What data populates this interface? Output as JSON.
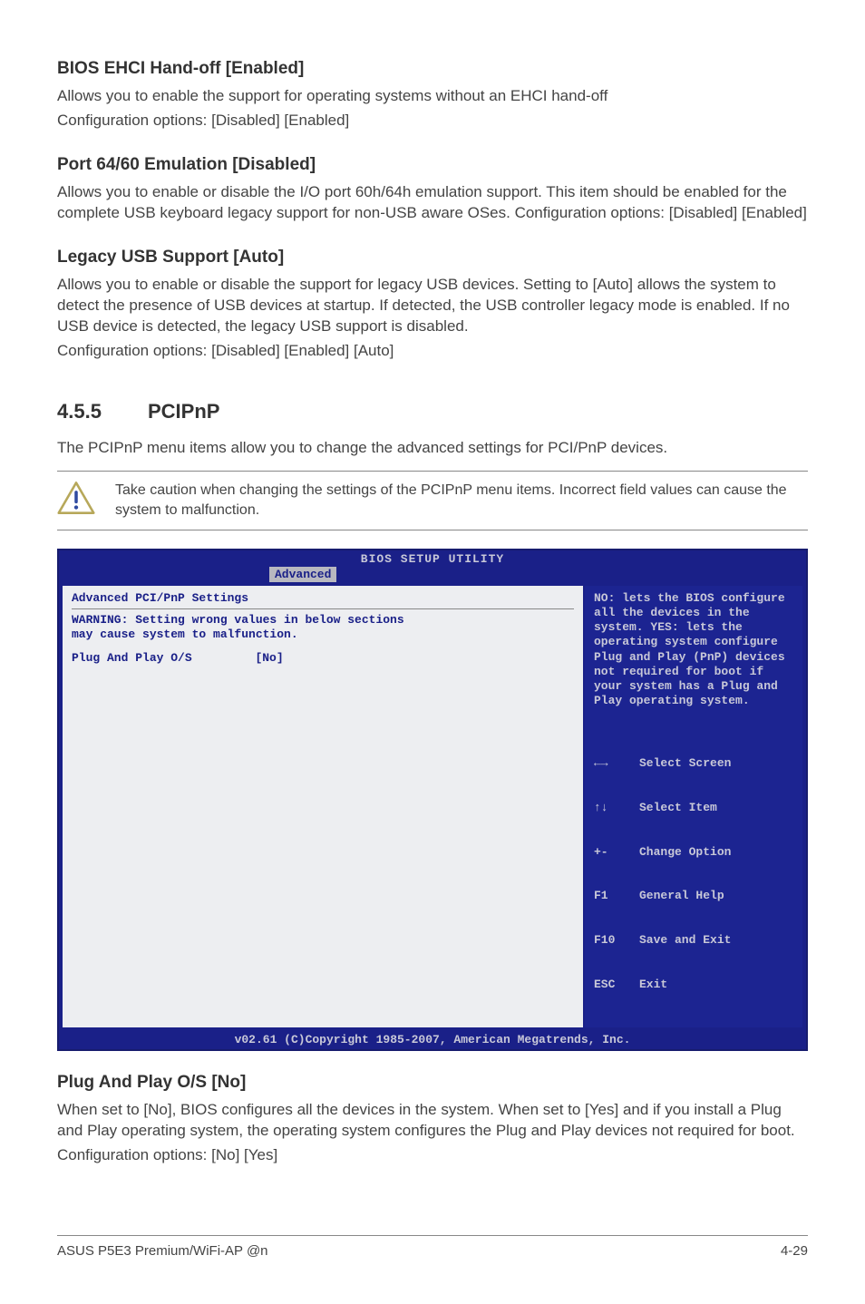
{
  "s1": {
    "head": "BIOS EHCI Hand-off [Enabled]",
    "p1": "Allows you to enable the support for operating systems without an EHCI hand-off",
    "p2": "Configuration options: [Disabled] [Enabled]"
  },
  "s2": {
    "head": "Port 64/60 Emulation [Disabled]",
    "p1": "Allows you to enable or disable the I/O port 60h/64h emulation support. This item should be enabled for the complete USB keyboard legacy support for non-USB aware OSes. Configuration options: [Disabled] [Enabled]"
  },
  "s3": {
    "head": "Legacy USB Support [Auto]",
    "p1": "Allows you to enable or disable the support for legacy USB devices. Setting to [Auto] allows the system to detect the presence of USB devices at startup. If detected, the USB controller legacy mode is enabled. If no USB device is detected, the legacy USB support is disabled.",
    "p2": "Configuration options: [Disabled] [Enabled] [Auto]"
  },
  "sec": {
    "num": "4.5.5",
    "title": "PCIPnP",
    "intro": "The PCIPnP menu items allow you to change the advanced settings for PCI/PnP devices."
  },
  "note": "Take caution when changing the settings of the PCIPnP menu items. Incorrect field values can cause the system to malfunction.",
  "bios": {
    "title": "BIOS SETUP UTILITY",
    "tab": "Advanced",
    "left_header": "Advanced PCI/PnP Settings",
    "warn1": "WARNING: Setting wrong values in below sections",
    "warn2": "         may cause system to malfunction.",
    "opt_label": "Plug And Play O/S",
    "opt_value": "[No]",
    "help": "NO: lets the BIOS configure all the devices in the system. YES: lets the operating system configure Plug and Play (PnP) devices not required for boot if your system has a Plug and Play operating system.",
    "nav": [
      {
        "key": "←→",
        "label": "Select Screen"
      },
      {
        "key": "↑↓",
        "label": "Select Item"
      },
      {
        "key": "+-",
        "label": "Change Option"
      },
      {
        "key": "F1",
        "label": "General Help"
      },
      {
        "key": "F10",
        "label": "Save and Exit"
      },
      {
        "key": "ESC",
        "label": "Exit"
      }
    ],
    "footer": "v02.61 (C)Copyright 1985-2007, American Megatrends, Inc."
  },
  "s4": {
    "head": "Plug And Play O/S [No]",
    "p1": "When set to [No], BIOS configures all the devices in the system. When set to [Yes] and if you install a Plug and Play operating system, the operating system configures the Plug and Play devices not required for boot.",
    "p2": "Configuration options: [No] [Yes]"
  },
  "footer": {
    "left": "ASUS P5E3 Premium/WiFi-AP @n",
    "right": "4-29"
  }
}
